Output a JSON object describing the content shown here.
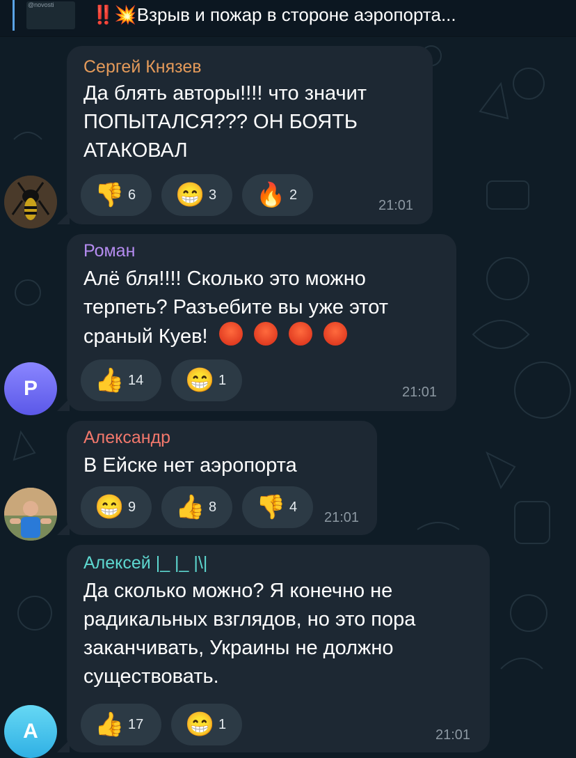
{
  "pinned": {
    "thumb_caption": "@novosti",
    "text": "‼️💥Взрыв и пожар в стороне аэропорта..."
  },
  "messages": [
    {
      "author": "Сергей Князев",
      "author_color": "#e49a5a",
      "lines": [
        "Да блять авторы!!!! что значит",
        "ПОПЫТАЛСЯ??? ОН БОЯТЬ",
        "АТАКОВАЛ"
      ],
      "reactions": [
        {
          "icon": "thumbs-down-icon",
          "emoji": "👎",
          "count": "6"
        },
        {
          "icon": "grin-face-icon",
          "emoji": "😁",
          "count": "3"
        },
        {
          "icon": "fire-icon",
          "emoji": "🔥",
          "count": "2"
        }
      ],
      "time": "21:01",
      "avatar": {
        "type": "image",
        "icon": "wasp-avatar"
      }
    },
    {
      "author": "Роман",
      "author_color": "#b58cf0",
      "lines": [
        "Алё бля!!!! Сколько это можно",
        "терпеть? Разъебите вы уже этот",
        "сраный Куев!"
      ],
      "inline_emojis": [
        "😡",
        "😡",
        "😡",
        "😡"
      ],
      "reactions": [
        {
          "icon": "thumbs-up-icon",
          "emoji": "👍",
          "count": "14"
        },
        {
          "icon": "grin-face-icon",
          "emoji": "😁",
          "count": "1"
        }
      ],
      "time": "21:01",
      "avatar": {
        "type": "letter",
        "letter": "Р",
        "color": "#6e6cf0"
      }
    },
    {
      "author": "Александр",
      "author_color": "#f2786c",
      "lines": [
        "В Ейске нет аэропорта"
      ],
      "reactions": [
        {
          "icon": "grin-face-icon",
          "emoji": "😁",
          "count": "9"
        },
        {
          "icon": "thumbs-up-icon",
          "emoji": "👍",
          "count": "8"
        },
        {
          "icon": "thumbs-down-icon",
          "emoji": "👎",
          "count": "4"
        }
      ],
      "time": "21:01",
      "avatar": {
        "type": "image",
        "icon": "person-avatar"
      }
    },
    {
      "author": "Алексей |_ |_ |\\|",
      "author_color": "#5ed8d0",
      "lines": [
        "Да сколько можно? Я конечно не",
        "радикальных взглядов, но это пора",
        "заканчивать, Украины не должно",
        "существовать."
      ],
      "reactions": [
        {
          "icon": "thumbs-up-icon",
          "emoji": "👍",
          "count": "17"
        },
        {
          "icon": "grin-face-icon",
          "emoji": "😁",
          "count": "1"
        }
      ],
      "time": "21:01",
      "avatar": {
        "type": "letter",
        "letter": "А",
        "color": "#3fc0ea"
      }
    }
  ]
}
